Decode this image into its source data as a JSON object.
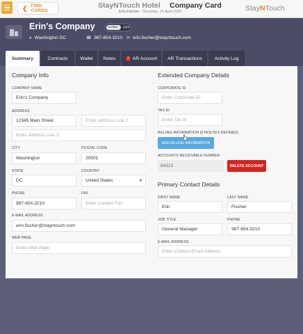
{
  "topbar": {
    "find_cards_label": "FIND CARDS",
    "hotel_name": "StayNTouch Hotel",
    "page_title": "Company Card",
    "user_name": "Erin Fischer",
    "date": "Thursday, 15 April 2021",
    "brand_prefix": "Stay",
    "brand_n": "N",
    "brand_suffix": "Touch"
  },
  "header": {
    "company_name": "Erin's Company",
    "toggle_global": "GLOBAL",
    "toggle_off": "OFF",
    "location": "Washington DC",
    "phone": "987-654-3210",
    "email": "erin.fischer@stayntouch.com"
  },
  "tabs": [
    {
      "label": "Summary",
      "active": true
    },
    {
      "label": "Contracts"
    },
    {
      "label": "Wallet"
    },
    {
      "label": "Notes"
    },
    {
      "label": "AR Account",
      "badge": "!"
    },
    {
      "label": "AR Transactions"
    },
    {
      "label": "Activity Log"
    }
  ],
  "company_info": {
    "title": "Company Info",
    "company_name_label": "COMPANY NAME",
    "company_name_value": "Erin's Company",
    "address_label": "ADDRESS",
    "address1_value": "12345 Main Street",
    "address2_placeholder": "Enter Address Line 2",
    "address3_placeholder": "Enter Address Line 3",
    "city_label": "CITY",
    "city_value": "Washington",
    "postal_label": "POSTAL CODE",
    "postal_value": "20001",
    "state_label": "STATE",
    "state_value": "DC",
    "country_label": "COUNTRY",
    "country_value": "United States",
    "phone_label": "PHONE",
    "phone_value": "987-654-3210",
    "fax_label": "FAX",
    "fax_placeholder": "Enter Contact Fax",
    "email_label": "E-MAIL ADDRESS",
    "email_value": "erin.fischer@stayntouch.com",
    "webpage_label": "WEB PAGE",
    "webpage_placeholder": "Enter Web Page"
  },
  "extended": {
    "title": "Extended Company Details",
    "corp_id_label": "CORPORATE ID",
    "corp_id_placeholder": "Enter Corporate ID",
    "tax_id_label": "TAX ID",
    "tax_id_placeholder": "Enter Tax Id",
    "billing_label": "BILLING INFORMATION (0 ROUTES DEFINED)",
    "add_billing_button": "ADD BILLING INFORMATION",
    "ar_number_label": "ACCOUNTS RECEIVABLE NUMBER",
    "ar_number_value": "84313",
    "delete_button": "DELETE ACCOUNT"
  },
  "primary_contact": {
    "title": "Primary Contact Details",
    "first_name_label": "FIRST NAME",
    "first_name_value": "Erin",
    "last_name_label": "LAST NAME",
    "last_name_value": "Fischer",
    "job_title_label": "JOB TITLE",
    "job_title_value": "General Manager",
    "phone_label": "PHONE",
    "phone_value": "987-654-3210",
    "email_label": "E-MAIL ADDRESS",
    "email_placeholder": "Enter Contact Email Address"
  },
  "colors": {
    "accent_orange": "#e08a1e",
    "header_bg": "#4a4d65",
    "danger_red": "#d42420",
    "info_blue": "#5aa9e0"
  },
  "icons": {
    "menu": "hamburger-icon",
    "find_cards": "arrow-left-icon",
    "company": "building-icon",
    "location": "map-pin-icon",
    "phone": "phone-icon",
    "email": "envelope-icon",
    "select": "caret-down-icon",
    "cursor": "pointer-cursor-icon"
  }
}
